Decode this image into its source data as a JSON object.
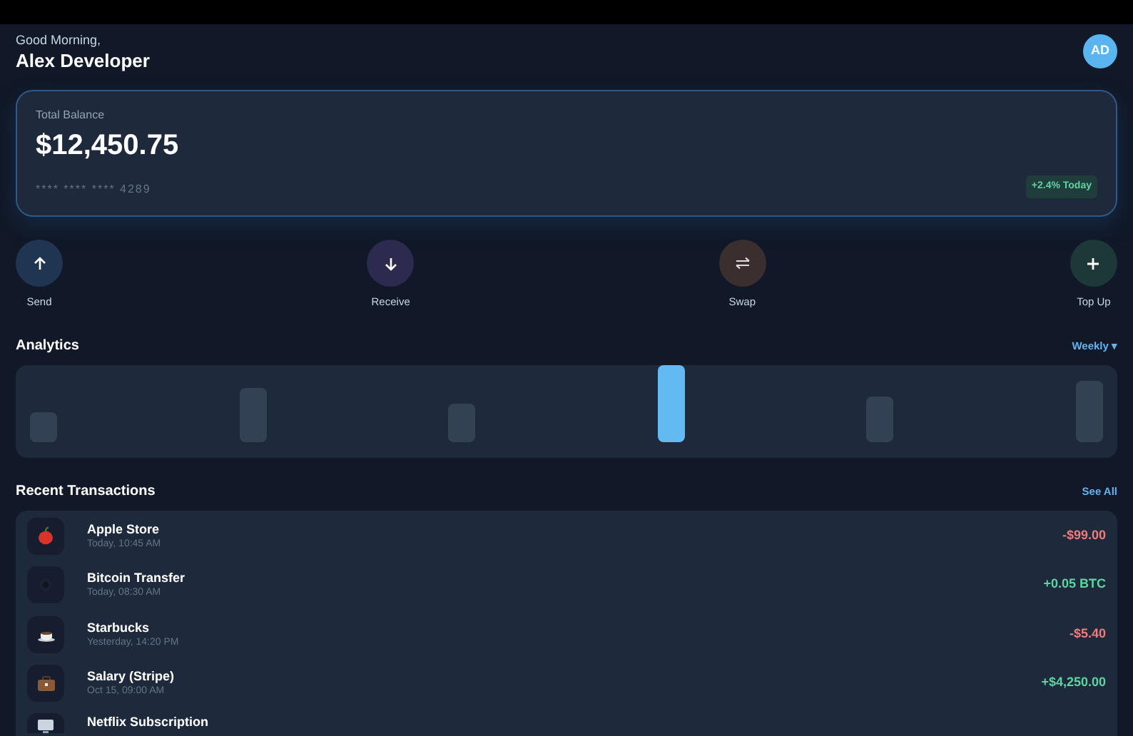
{
  "header": {
    "greeting": "Good Morning,",
    "name": "Alex Developer",
    "avatar": "AD"
  },
  "balance_card": {
    "label": "Total Balance",
    "amount": "$12,450.75",
    "card_number": "**** **** **** 4289",
    "change": "+2.4% Today"
  },
  "actions": [
    {
      "label": "Send",
      "color": "#1f3552"
    },
    {
      "label": "Receive",
      "color": "#2c2a4f"
    },
    {
      "label": "Swap",
      "color": "#3a2e2e"
    },
    {
      "label": "Top Up",
      "color": "#1c3838"
    }
  ],
  "analytics": {
    "title": "Analytics",
    "period": "Weekly ▾",
    "bars": [
      {
        "selected": false
      },
      {
        "selected": false
      },
      {
        "selected": false
      },
      {
        "selected": true
      },
      {
        "selected": false
      },
      {
        "selected": false
      }
    ]
  },
  "transactions": {
    "title": "Recent Transactions",
    "link": "See All",
    "rows": [
      {
        "name": "Apple Store",
        "time": "Today, 10:45 AM",
        "amount": "-$99.00",
        "kind": "debit"
      },
      {
        "name": "Bitcoin Transfer",
        "time": "Today, 08:30 AM",
        "amount": "+0.05 BTC",
        "kind": "credit"
      },
      {
        "name": "Starbucks",
        "time": "Yesterday, 14:20 PM",
        "amount": "-$5.40",
        "kind": "debit"
      },
      {
        "name": "Salary (Stripe)",
        "time": "Oct 15, 09:00 AM",
        "amount": "+$4,250.00",
        "kind": "credit"
      },
      {
        "name": "Netflix Subscription"
      }
    ]
  }
}
